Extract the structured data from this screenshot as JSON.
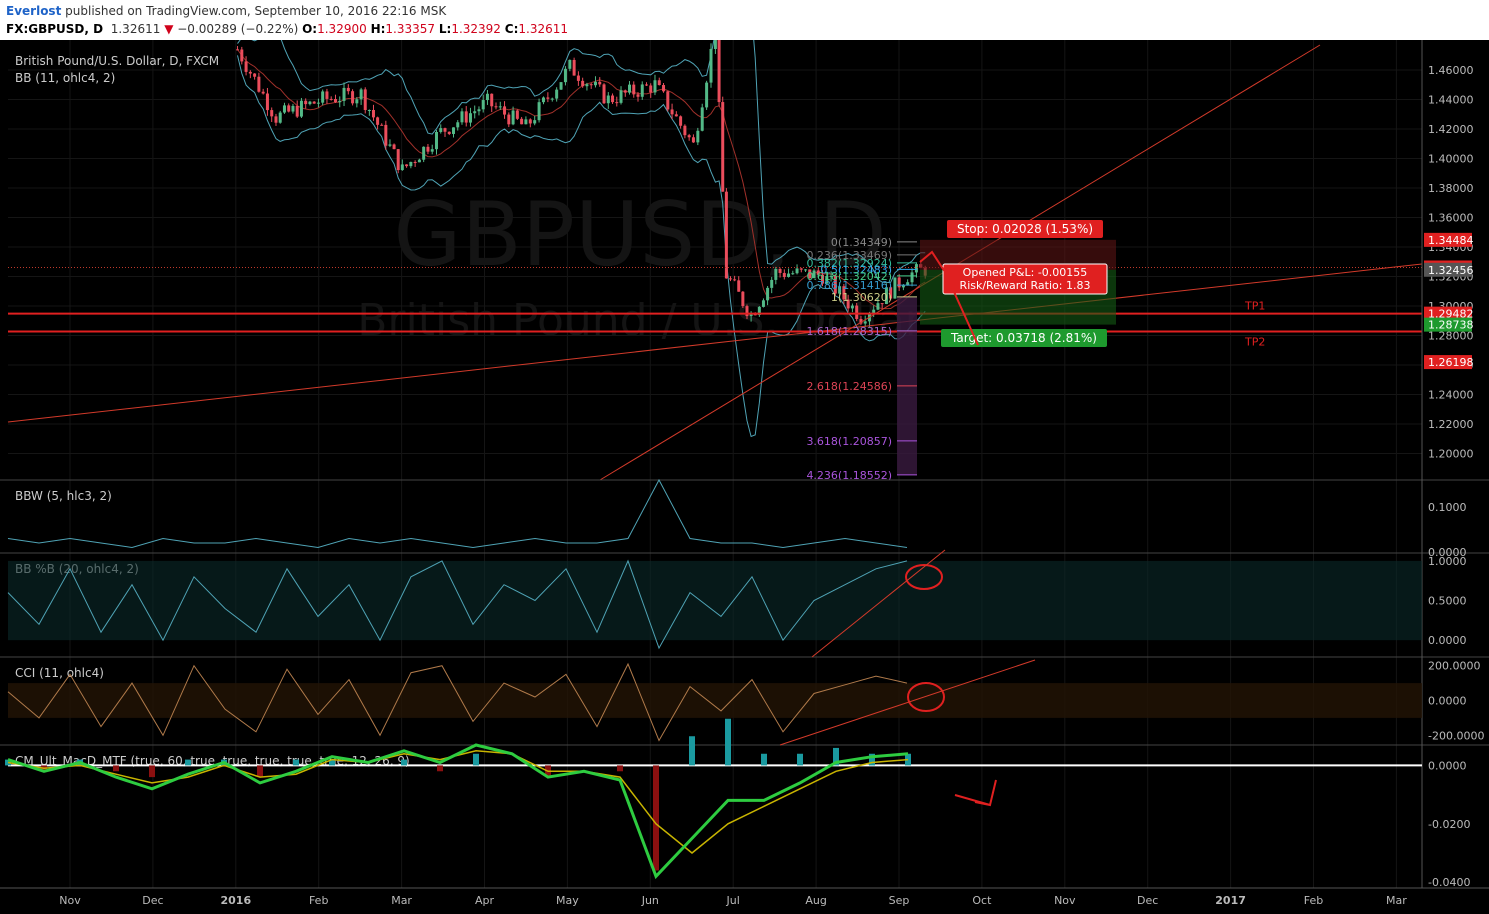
{
  "header": {
    "author": "Everlost",
    "published": "published on TradingView.com, September 10, 2016 22:16 MSK",
    "symbol": "FX:GBPUSD, D",
    "last": "1.32611",
    "arrow": "▼",
    "change": "−0.00289 (−0.22%)",
    "o_label": "O:",
    "o_val": "1.32900",
    "h_label": "H:",
    "h_val": "1.33357",
    "l_label": "L:",
    "l_val": "1.32392",
    "c_label": "C:",
    "c_val": "1.32611"
  },
  "colors": {
    "bg": "#000000",
    "up": "#53b987",
    "down": "#eb4d5c",
    "bb": "#4fa3b5",
    "red_line": "#e02020",
    "grid": "#151515",
    "text": "#bbbbbb",
    "macd_green": "#2ecc40",
    "macd_red": "#cc1010",
    "macd_signal": "#c8b400"
  },
  "main": {
    "title": "British Pound/U.S. Dollar, D, FXCM",
    "indicator": "BB (11, ohlc4, 2)",
    "watermark_symbol": "GBPUSD, D",
    "watermark_name": "British Pound / U.S. Dollar"
  },
  "chart_data": [
    {
      "type": "candlestick",
      "title": "British Pound/U.S. Dollar, D, FXCM",
      "xlabel": "",
      "ylabel": "",
      "ylim": [
        1.18,
        1.48
      ],
      "y_ticks": [
        "1.46000",
        "1.44000",
        "1.42000",
        "1.40000",
        "1.38000",
        "1.36000",
        "1.34000",
        "1.32000",
        "1.30000",
        "1.28000",
        "1.26000",
        "1.24000",
        "1.22000",
        "1.20000"
      ],
      "x_ticks": [
        "Nov",
        "Dec",
        "2016",
        "Feb",
        "Mar",
        "Apr",
        "May",
        "Jun",
        "Jul",
        "Aug",
        "Sep",
        "Oct",
        "Nov",
        "Dec",
        "2017",
        "Feb",
        "Mar"
      ],
      "approx_closes": [
        {
          "x": "2016-01-01",
          "y": 1.474
        },
        {
          "x": "2016-01-15",
          "y": 1.428
        },
        {
          "x": "2016-02-01",
          "y": 1.44
        },
        {
          "x": "2016-02-15",
          "y": 1.444
        },
        {
          "x": "2016-03-01",
          "y": 1.392
        },
        {
          "x": "2016-03-15",
          "y": 1.418
        },
        {
          "x": "2016-04-01",
          "y": 1.438
        },
        {
          "x": "2016-04-15",
          "y": 1.421
        },
        {
          "x": "2016-05-01",
          "y": 1.462
        },
        {
          "x": "2016-05-15",
          "y": 1.44
        },
        {
          "x": "2016-06-01",
          "y": 1.45
        },
        {
          "x": "2016-06-15",
          "y": 1.409
        },
        {
          "x": "2016-06-23",
          "y": 1.488
        },
        {
          "x": "2016-06-27",
          "y": 1.321
        },
        {
          "x": "2016-07-06",
          "y": 1.294
        },
        {
          "x": "2016-07-15",
          "y": 1.323
        },
        {
          "x": "2016-08-01",
          "y": 1.321
        },
        {
          "x": "2016-08-15",
          "y": 1.293
        },
        {
          "x": "2016-09-01",
          "y": 1.321
        },
        {
          "x": "2016-09-09",
          "y": 1.326
        }
      ],
      "price_labels": [
        {
          "value": "1.34484",
          "kind": "stop"
        },
        {
          "value": "1.32611",
          "kind": "last"
        },
        {
          "value": "1.32456",
          "kind": "current"
        },
        {
          "value": "1.29482",
          "kind": "tp1"
        },
        {
          "value": "1.28738",
          "kind": "target"
        },
        {
          "value": "1.26198",
          "kind": "tp2"
        }
      ],
      "horizontal_lines": [
        {
          "name": "TP1",
          "y": 1.29482
        },
        {
          "name": "TP2",
          "y": 1.2827
        }
      ],
      "fibonacci": [
        {
          "label": "0(1.34349)",
          "y": 1.34349
        },
        {
          "label": "0.236(1.33469)",
          "y": 1.33469
        },
        {
          "label": "0.382(1.32924)",
          "y": 1.32924
        },
        {
          "label": "0.5(1.32483)",
          "y": 1.32483
        },
        {
          "label": "0.618(1.32042)",
          "y": 1.32042
        },
        {
          "label": "0.786(1.31416)",
          "y": 1.31416
        },
        {
          "label": "1(1.30620)",
          "y": 1.3062
        },
        {
          "label": "1.618(1.28315)",
          "y": 1.28315
        },
        {
          "label": "2.618(1.24586)",
          "y": 1.24586
        },
        {
          "label": "3.618(1.20857)",
          "y": 1.20857
        },
        {
          "label": "4.236(1.18552)",
          "y": 1.18552
        }
      ],
      "position": {
        "stop": "Stop: 0.02028 (1.53%)",
        "pnl": "Opened P&L: -0.00155",
        "rr": "Risk/Reward Ratio: 1.83",
        "target": "Target: 0.03718 (2.81%)"
      },
      "legend": "top-left",
      "grid": true
    },
    {
      "type": "line",
      "title": "BBW (5, hlc3, 2)",
      "y_ticks": [
        "0.1000",
        "0.0000"
      ],
      "ylim": [
        0,
        0.16
      ],
      "series": [
        {
          "values": [
            0.03,
            0.02,
            0.03,
            0.02,
            0.01,
            0.03,
            0.02,
            0.02,
            0.03,
            0.02,
            0.01,
            0.03,
            0.02,
            0.03,
            0.02,
            0.01,
            0.02,
            0.03,
            0.02,
            0.02,
            0.03,
            0.16,
            0.03,
            0.02,
            0.02,
            0.01,
            0.02,
            0.03,
            0.02,
            0.01
          ]
        }
      ]
    },
    {
      "type": "line",
      "title": "BB %B (20, ohlc4, 2)",
      "y_ticks": [
        "1.0000",
        "0.5000",
        "0.0000"
      ],
      "ylim": [
        -0.2,
        1.1
      ],
      "series": [
        {
          "values": [
            0.6,
            0.2,
            0.9,
            0.1,
            0.7,
            0.0,
            0.8,
            0.4,
            0.1,
            0.9,
            0.3,
            0.7,
            0.0,
            0.8,
            1.0,
            0.2,
            0.7,
            0.5,
            0.9,
            0.1,
            1.0,
            -0.1,
            0.6,
            0.3,
            0.8,
            0.0,
            0.5,
            0.7,
            0.9,
            1.0
          ]
        }
      ]
    },
    {
      "type": "line",
      "title": "CCI (11, ohlc4)",
      "y_ticks": [
        "200.0000",
        "0.0000",
        "-200.0000"
      ],
      "ylim": [
        -250,
        250
      ],
      "series": [
        {
          "values": [
            50,
            -100,
            150,
            -150,
            100,
            -200,
            200,
            -50,
            -180,
            180,
            -80,
            120,
            -200,
            160,
            200,
            -120,
            100,
            20,
            150,
            -150,
            210,
            -230,
            80,
            -60,
            120,
            -180,
            40,
            90,
            140,
            100
          ]
        }
      ]
    },
    {
      "type": "area",
      "title": "CM_Ult_MacD_MTF (true, 60, true, true, true, true, true, 12, 26, 9)",
      "y_ticks": [
        "0.0000",
        "-0.0200",
        "-0.0400"
      ],
      "ylim": [
        -0.042,
        0.007
      ],
      "series": [
        {
          "name": "macd",
          "values": [
            0.002,
            -0.002,
            0.001,
            -0.004,
            -0.008,
            -0.003,
            0.001,
            -0.006,
            -0.002,
            0.003,
            0.001,
            0.005,
            0.001,
            0.007,
            0.004,
            -0.004,
            -0.002,
            -0.005,
            -0.038,
            -0.025,
            -0.012,
            -0.012,
            -0.006,
            0.001,
            0.003,
            0.004
          ]
        },
        {
          "name": "signal",
          "values": [
            0.001,
            -0.001,
            0.0,
            -0.003,
            -0.006,
            -0.004,
            0.0,
            -0.004,
            -0.003,
            0.002,
            0.001,
            0.004,
            0.002,
            0.005,
            0.004,
            -0.002,
            -0.002,
            -0.004,
            -0.02,
            -0.03,
            -0.02,
            -0.014,
            -0.008,
            -0.002,
            0.001,
            0.002
          ]
        }
      ]
    }
  ]
}
